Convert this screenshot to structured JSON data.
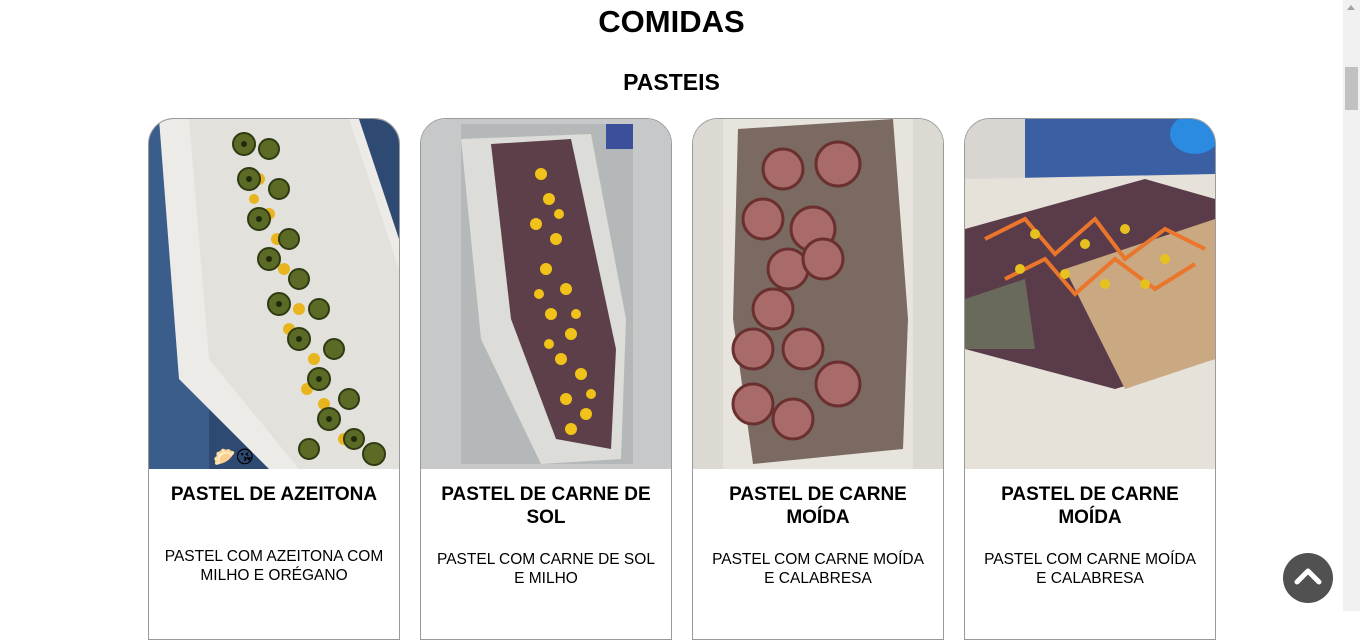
{
  "header": {
    "title": "COMIDAS",
    "section_title": "PASTEIS"
  },
  "cards": [
    {
      "title": "PASTEL DE AZEITONA",
      "description": "PASTEL COM AZEITONA COM MILHO E ORÉGANO",
      "photo_sticker": "🥟😘"
    },
    {
      "title": "PASTEL DE CARNE DE SOL",
      "description": "PASTEL COM CARNE DE SOL E MILHO"
    },
    {
      "title": "PASTEL DE CARNE MOÍDA",
      "description": "PASTEL COM CARNE MOÍDA E CALABRESA"
    },
    {
      "title": "PASTEL DE CARNE MOÍDA",
      "description": "PASTEL COM CARNE MOÍDA E CALABRESA"
    }
  ],
  "back_to_top": {
    "icon": "chevron-up-icon"
  },
  "colors": {
    "card_border": "#9a9a9a",
    "back_to_top_bg": "#515151",
    "scrollbar_thumb": "#c1c1c1"
  }
}
